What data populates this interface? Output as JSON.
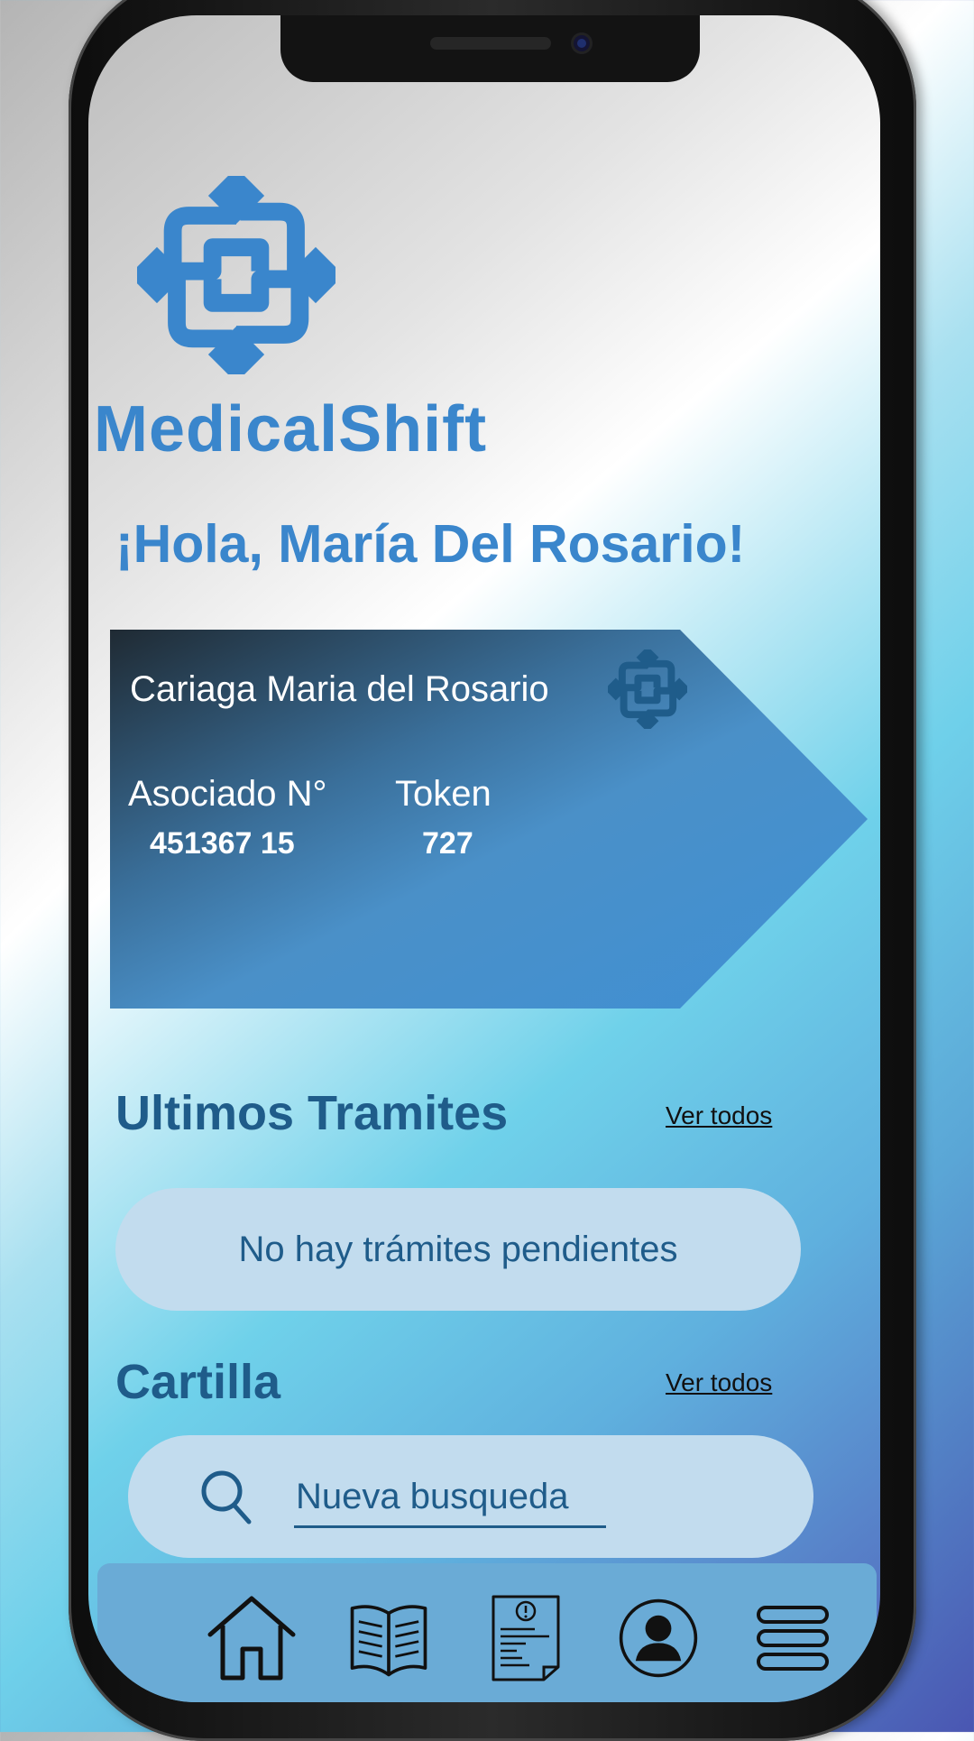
{
  "app": {
    "brand_name": "MedicalShift",
    "greeting": "¡Hola, María Del Rosario!",
    "colors": {
      "brand_blue": "#3a86cc",
      "dark_text": "#1f5c8a",
      "pill_bg": "#c2dcee",
      "navbar_bg": "#6aabd6"
    }
  },
  "card": {
    "holder_name": "Cariaga Maria del Rosario",
    "associate_label": "Asociado N°",
    "associate_number": "451367 15",
    "token_label": "Token",
    "token_value": "727"
  },
  "tramites": {
    "title": "Ultimos Tramites",
    "see_all": "Ver todos",
    "empty_message": "No hay trámites pendientes"
  },
  "cartilla": {
    "title": "Cartilla",
    "see_all": "Ver todos",
    "search_placeholder": "Nueva busqueda"
  },
  "navbar": {
    "items": [
      {
        "icon": "home-icon"
      },
      {
        "icon": "book-icon"
      },
      {
        "icon": "document-alert-icon"
      },
      {
        "icon": "user-profile-icon"
      },
      {
        "icon": "menu-icon"
      }
    ]
  }
}
